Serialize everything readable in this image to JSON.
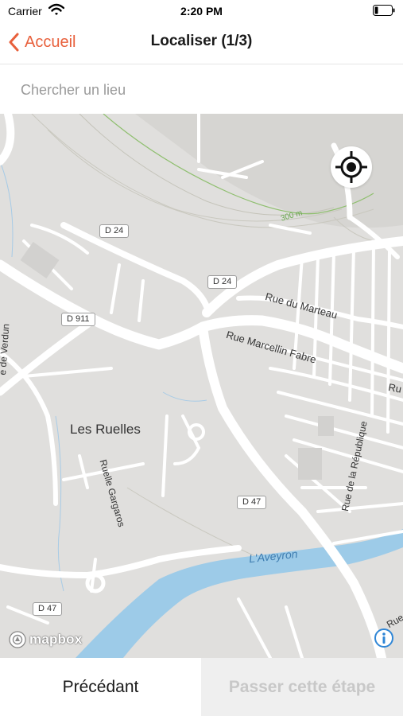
{
  "status_bar": {
    "carrier": "Carrier",
    "time": "2:20 PM",
    "wifi_icon": "wifi-icon",
    "battery_icon": "battery-low-icon"
  },
  "nav": {
    "back_label": "Accueil",
    "title": "Localiser (1/3)",
    "accent_color": "#e8603c"
  },
  "search": {
    "placeholder": "Chercher un lieu",
    "value": ""
  },
  "map": {
    "attribution_logo": "mapbox",
    "locate_icon": "gps-crosshair-icon",
    "info_icon": "info-icon",
    "water_color": "#9dcbe8",
    "labels": {
      "place": "Les Ruelles",
      "river": "L'Aveyron",
      "street_marteau": "Rue du Marteau",
      "street_marcellin": "Rue Marcellin Fabre",
      "street_gargaros": "Ruelle Gargaros",
      "street_republique": "Rue de la République",
      "street_verdun": "e de Verdun",
      "street_ru": "Ru",
      "street_rue": "Rue",
      "contour": "300 m"
    },
    "road_shields": {
      "d24_a": "D 24",
      "d24_b": "D 24",
      "d911": "D 911",
      "d47_a": "D 47",
      "d47_b": "D 47"
    }
  },
  "footer": {
    "previous_label": "Précédant",
    "skip_label": "Passer cette étape"
  }
}
